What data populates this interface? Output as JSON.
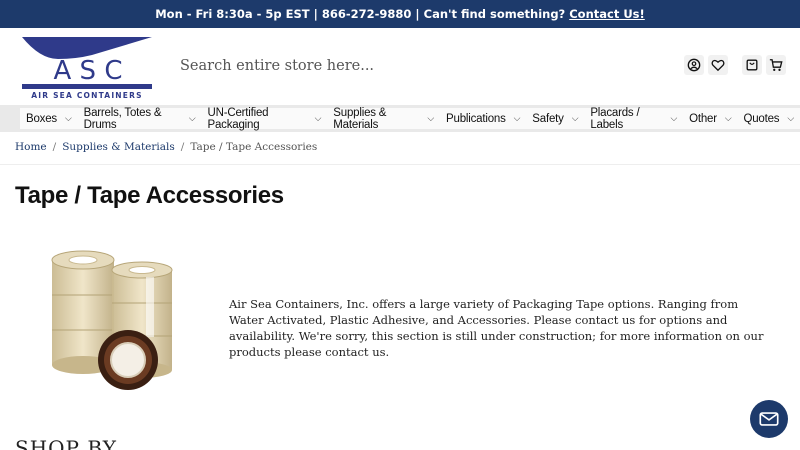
{
  "topbar": {
    "text": "Mon - Fri 8:30a - 5p EST | 866-272-9880 | Can't find something?",
    "link": "Contact Us!"
  },
  "logo": {
    "letters": "A S C",
    "tagline": "AIR SEA CONTAINERS"
  },
  "search": {
    "placeholder": "Search entire store here..."
  },
  "nav": {
    "items": [
      {
        "label": "Boxes"
      },
      {
        "label": "Barrels, Totes & Drums"
      },
      {
        "label": "UN-Certified Packaging"
      },
      {
        "label": "Supplies & Materials"
      },
      {
        "label": "Publications"
      },
      {
        "label": "Safety"
      },
      {
        "label": "Placards / Labels"
      },
      {
        "label": "Other"
      },
      {
        "label": "Quotes"
      }
    ]
  },
  "breadcrumb": {
    "home": "Home",
    "parent": "Supplies & Materials",
    "current": "Tape / Tape Accessories"
  },
  "page": {
    "title": "Tape / Tape Accessories",
    "description": "Air Sea Containers, Inc. offers a large variety of Packaging Tape options. Ranging from Water Activated, Plastic Adhesive, and Accessories. Please contact us for options and availability. We're sorry, this section is still under construction; for more information on our products please contact us.",
    "shop_by": "SHOP BY"
  },
  "colors": {
    "brand": "#1d3a6b",
    "nav_bg": "#e9e9e9"
  }
}
